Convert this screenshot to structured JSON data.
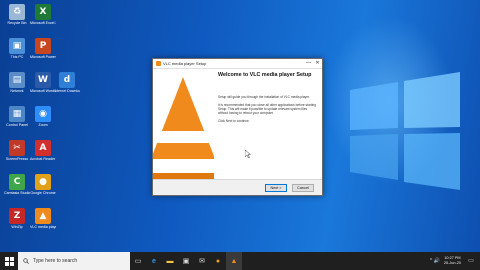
{
  "desktop": {
    "icons": [
      {
        "name": "Recycle Bin",
        "glyph": "♻",
        "color": "#9ab7d8"
      },
      {
        "name": "Microsoft Excel 2010",
        "glyph": "X",
        "color": "#1f7a3a"
      },
      {
        "name": "This PC",
        "glyph": "▣",
        "color": "#4a8fd8"
      },
      {
        "name": "Microsoft PowerPoint 2010",
        "glyph": "P",
        "color": "#c8461f"
      },
      {
        "name": "Network",
        "glyph": "▤",
        "color": "#5a8cc8"
      },
      {
        "name": "Microsoft Word 2010",
        "glyph": "W",
        "color": "#2b5ba8"
      },
      {
        "name": "Internet Download Manager",
        "glyph": "d",
        "color": "#2f7fd6"
      },
      {
        "name": "Control Panel",
        "glyph": "▦",
        "color": "#4c86c6"
      },
      {
        "name": "Zoom",
        "glyph": "◉",
        "color": "#2d8cff"
      },
      {
        "name": "ScreenPresso",
        "glyph": "✂",
        "color": "#c0392b"
      },
      {
        "name": "Acrobat Reader DC",
        "glyph": "A",
        "color": "#d32f2f"
      },
      {
        "name": "Camtasia Studio",
        "glyph": "C",
        "color": "#3fa64a"
      },
      {
        "name": "Google Chrome",
        "glyph": "●",
        "color": "#e2a11a"
      },
      {
        "name": "WinZip",
        "glyph": "Z",
        "color": "#c62828"
      },
      {
        "name": "VLC media player",
        "glyph": "▲",
        "color": "#f08a1c"
      }
    ]
  },
  "dialog": {
    "title": "VLC media player Setup",
    "heading": "Welcome to VLC media player Setup",
    "para1": "Setup will guide you through the installation of VLC media player.",
    "para2": "It is recommended that you close all other applications before starting Setup. This will make it possible to update relevant system files without having to reboot your computer.",
    "para3": "Click Next to continue.",
    "next_label": "Next >",
    "cancel_label": "Cancel",
    "minimize_symbol": "—",
    "close_symbol": "✕"
  },
  "taskbar": {
    "search_placeholder": "Type here to search",
    "tray_symbols": "^ 🔊",
    "time": "10:27 PM",
    "date": "25-Jun-20",
    "notifications_symbol": "▭"
  },
  "colors": {
    "vlc_orange": "#f08a1c",
    "desktop_blue": "#1565c9",
    "taskbar": "#1f1f1f"
  }
}
